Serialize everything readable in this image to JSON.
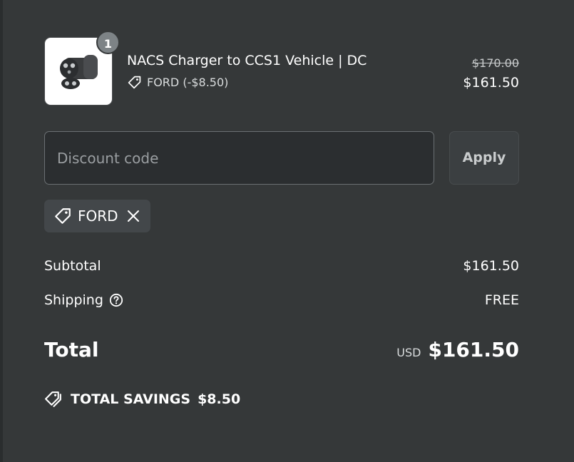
{
  "line_item": {
    "quantity": "1",
    "title": "NACS Charger to CCS1 Vehicle | DC",
    "discount_label": "FORD (-$8.50)",
    "original_price": "$170.00",
    "price": "$161.50",
    "image_icon": "nacs-adapter-image"
  },
  "discount": {
    "placeholder": "Discount code",
    "value": "",
    "apply_label": "Apply",
    "applied_code": "FORD"
  },
  "summary": {
    "subtotal_label": "Subtotal",
    "subtotal_value": "$161.50",
    "shipping_label": "Shipping",
    "shipping_value": "FREE",
    "total_label": "Total",
    "currency": "USD",
    "total_value": "$161.50",
    "savings_label": "TOTAL SAVINGS",
    "savings_value": "$8.50"
  },
  "colors": {
    "background": "#353839",
    "text": "#ffffff",
    "badge": "#7d8386",
    "input_bg": "#2b2e30"
  }
}
